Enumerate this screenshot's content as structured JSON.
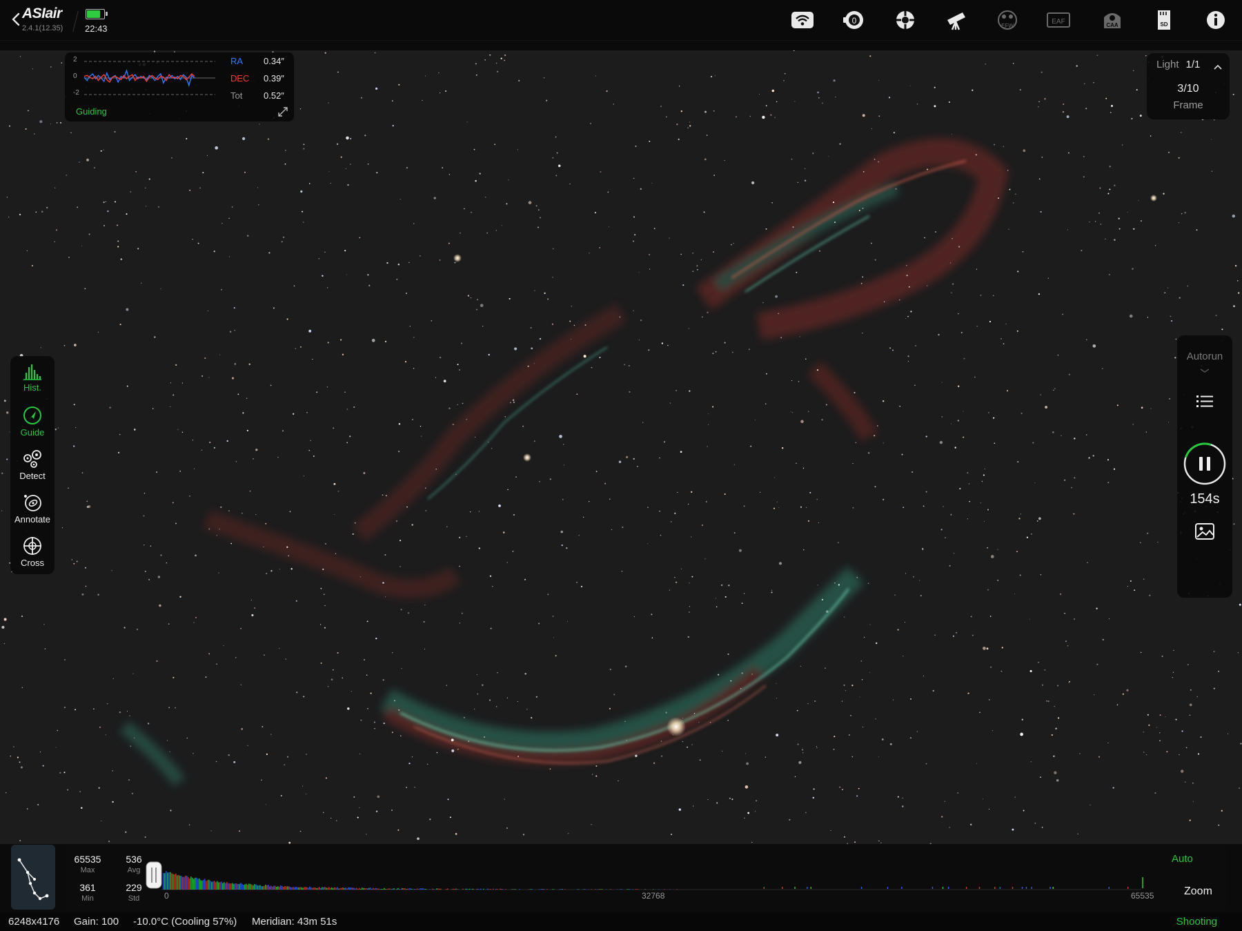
{
  "app": {
    "logo": "ASIair",
    "version": "2.4.1(12.35)",
    "clock": "22:43",
    "battery_level": 0.85,
    "battery_color": "#2ecc40",
    "accent_color": "#27c93f"
  },
  "toolbar_icons": [
    "wifi-icon",
    "camera-icon",
    "mount-target-icon",
    "telescope-icon",
    "efw-icon",
    "eaf-icon",
    "caa-icon",
    "sd-card-icon",
    "info-icon"
  ],
  "toolbar_labels": {
    "efw": "EFW",
    "eaf": "EAF",
    "caa": "CAA",
    "sd": "SD"
  },
  "guiding": {
    "ticks": [
      "2",
      "0",
      "-2"
    ],
    "ra_label": "RA",
    "ra_value": "0.34″",
    "ra_color": "#2d7cff",
    "dec_label": "DEC",
    "dec_value": "0.39″",
    "dec_color": "#ff3b30",
    "tot_label": "Tot",
    "tot_value": "0.52″",
    "status": "Guiding",
    "ra_series": [
      0.1,
      -0.3,
      0.2,
      0.5,
      -0.1,
      0.3,
      0.0,
      -0.4,
      0.6,
      -0.2,
      0.1,
      0.3,
      -0.5,
      0.2,
      0.0,
      0.9,
      -0.3,
      0.1,
      0.4,
      -0.1,
      0.2,
      0.0,
      -0.2,
      0.3,
      0.1,
      -0.3,
      0.2,
      0.5,
      -0.6,
      0.1,
      0.0,
      0.3,
      -0.1,
      0.2,
      -0.2,
      0.4,
      0.1,
      -0.9,
      0.3,
      0.0
    ],
    "dec_series": [
      0.2,
      0.3,
      0.1,
      -0.1,
      0.2,
      -0.3,
      0.1,
      0.4,
      -0.2,
      -0.5,
      0.1,
      0.2,
      0.0,
      -0.2,
      0.3,
      -0.1,
      0.2,
      0.4,
      -0.3,
      0.1,
      0.0,
      0.2,
      -0.4,
      0.1,
      0.3,
      0.0,
      -0.2,
      0.2,
      0.1,
      -0.3,
      0.4,
      0.0,
      0.1,
      -0.1,
      0.3,
      0.2,
      -0.2,
      0.1,
      0.5,
      0.2
    ]
  },
  "frame": {
    "type": "Light",
    "sequence": "1/1",
    "count": "3/10",
    "label": "Frame"
  },
  "tools": [
    {
      "id": "hist",
      "label": "Hist.",
      "icon": "histogram-icon",
      "active": true
    },
    {
      "id": "guide",
      "label": "Guide",
      "icon": "guide-icon",
      "active": true
    },
    {
      "id": "detect",
      "label": "Detect",
      "icon": "detect-stars-icon",
      "active": false
    },
    {
      "id": "annotate",
      "label": "Annotate",
      "icon": "annotate-galaxy-icon",
      "active": false
    },
    {
      "id": "cross",
      "label": "Cross",
      "icon": "crosshair-icon",
      "active": false
    }
  ],
  "capture": {
    "autorun": "Autorun",
    "exposure": "154s",
    "progress": 0.25
  },
  "histogram": {
    "max": "65535",
    "max_label": "Max",
    "avg": "536",
    "avg_label": "Avg",
    "min": "361",
    "min_label": "Min",
    "std": "229",
    "std_label": "Std",
    "axis_ticks": [
      "0",
      "32768",
      "65535"
    ],
    "auto_label": "Auto",
    "zoom_label": "Zoom"
  },
  "status": {
    "resolution": "6248x4176",
    "gain": "Gain: 100",
    "temperature": "-10.0°C (Cooling 57%)",
    "meridian": "Meridian: 43m 51s",
    "state": "Shooting"
  }
}
